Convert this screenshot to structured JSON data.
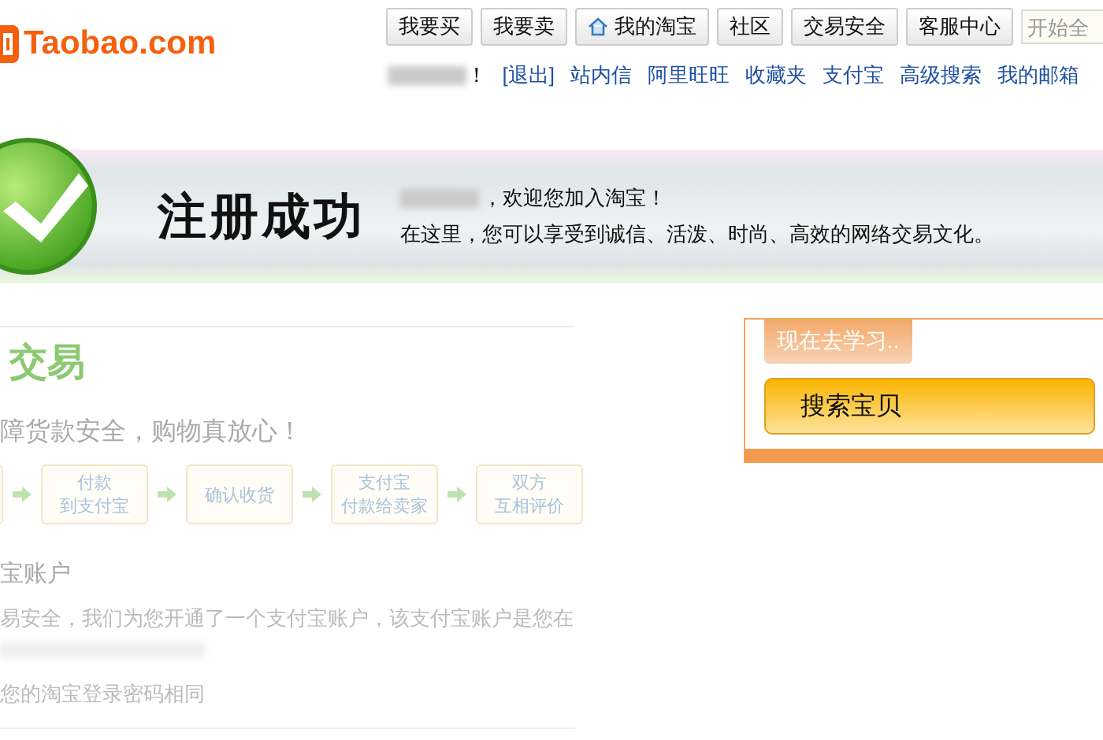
{
  "header": {
    "logo": "Taobao.com",
    "nav_buttons": [
      {
        "label": "我要买",
        "kind": "plain"
      },
      {
        "label": "我要卖",
        "kind": "plain"
      },
      {
        "label": "我的淘宝",
        "kind": "home"
      },
      {
        "label": "社区",
        "kind": "plain"
      },
      {
        "label": "交易安全",
        "kind": "plain"
      },
      {
        "label": "客服中心",
        "kind": "plain"
      }
    ],
    "search": {
      "placeholder": "开始全"
    },
    "user_suffix": "！",
    "user_links": [
      "[退出]",
      "站内信",
      "阿里旺旺",
      "收藏夹",
      "支付宝",
      "高级搜索",
      "我的邮箱"
    ]
  },
  "banner": {
    "title": "注册成功",
    "welcome": "，欢迎您加入淘宝！",
    "tagline": "在这里，您可以享受到诚信、活泼、时尚、高效的网络交易文化。"
  },
  "safe_trade": {
    "title": "交易",
    "subtitle": "障货款安全，购物真放心！",
    "steps": [
      {
        "lines": [
          "付款",
          "到支付宝"
        ]
      },
      {
        "lines": [
          "确认收货"
        ]
      },
      {
        "lines": [
          "支付宝",
          "付款给卖家"
        ]
      },
      {
        "lines": [
          "双方",
          "互相评价"
        ]
      }
    ],
    "account_heading": "宝账户",
    "account_text": "易安全，我们为您开通了一个支付宝账户，该支付宝账户是您在",
    "password_note": "您的淘宝登录密码相同"
  },
  "learn_box": {
    "tab": "现在去学习..",
    "button": "搜索宝贝"
  }
}
